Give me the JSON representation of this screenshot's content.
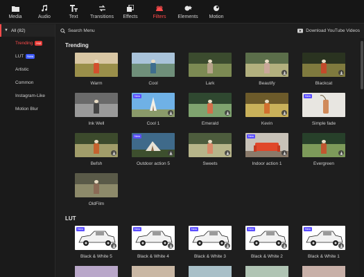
{
  "toolbar": {
    "items": [
      {
        "label": "Media",
        "icon": "folder-icon"
      },
      {
        "label": "Audio",
        "icon": "music-note-icon"
      },
      {
        "label": "Text",
        "icon": "text-icon"
      },
      {
        "label": "Transitions",
        "icon": "transitions-icon"
      },
      {
        "label": "Effects",
        "icon": "effects-icon"
      },
      {
        "label": "Filters",
        "icon": "filters-icon",
        "active": true
      },
      {
        "label": "Elements",
        "icon": "elements-icon"
      },
      {
        "label": "Motion",
        "icon": "motion-icon"
      }
    ]
  },
  "sidebar": {
    "all_label": "All (82)",
    "items": [
      {
        "label": "Trending",
        "badge": "Hot",
        "active": true
      },
      {
        "label": "LUT",
        "badge": "New"
      },
      {
        "label": "Artistic"
      },
      {
        "label": "Common"
      },
      {
        "label": "Instagram-Like"
      },
      {
        "label": "Motion Blur"
      }
    ]
  },
  "header": {
    "search_label": "Search Menu",
    "download_label": "Download YouTube Videos"
  },
  "sections": {
    "trending_title": "Trending",
    "lut_title": "LUT"
  },
  "trending": [
    {
      "name": "Warm"
    },
    {
      "name": "Cool"
    },
    {
      "name": "Lark"
    },
    {
      "name": "Beautify"
    },
    {
      "name": "Blackcat"
    },
    {
      "name": "Ink Well"
    },
    {
      "name": "Cool 1",
      "tag": "New"
    },
    {
      "name": "Emerald"
    },
    {
      "name": "Kevin"
    },
    {
      "name": "Simple fade",
      "tag": "New"
    },
    {
      "name": "Befsh"
    },
    {
      "name": "Outdoor action 5",
      "tag": "New"
    },
    {
      "name": "Sweets"
    },
    {
      "name": "Indoor action 1",
      "tag": "New"
    },
    {
      "name": "Evergreen"
    },
    {
      "name": "OldFilm"
    }
  ],
  "lut": [
    {
      "name": "Black & White 5",
      "tag": "New"
    },
    {
      "name": "Black & White 4",
      "tag": "New"
    },
    {
      "name": "Black & White 3",
      "tag": "New"
    },
    {
      "name": "Black & White 2",
      "tag": "New"
    },
    {
      "name": "Black & White 1",
      "tag": "New"
    }
  ],
  "colors": {
    "accent": "#ff4b4b",
    "new_badge": "#5a4dff",
    "hot_badge": "#e53935"
  }
}
